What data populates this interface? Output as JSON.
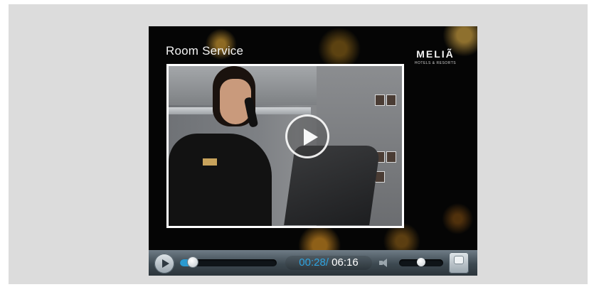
{
  "video": {
    "title": "Room Service",
    "brand": {
      "name": "MELIÃ",
      "tagline": "HOTELS & RESORTS"
    }
  },
  "controls": {
    "current_time": "00:28",
    "separator": "/",
    "total_time": "06:16",
    "progress_fraction": 0.074,
    "volume_fraction": 0.5
  },
  "colors": {
    "accent": "#2ea3e0",
    "background": "#dcdcdc",
    "player": "#000000"
  },
  "icons": {
    "big_play": "play-icon",
    "play_button": "play-icon",
    "volume": "speaker-icon",
    "fullscreen": "fullscreen-icon"
  }
}
